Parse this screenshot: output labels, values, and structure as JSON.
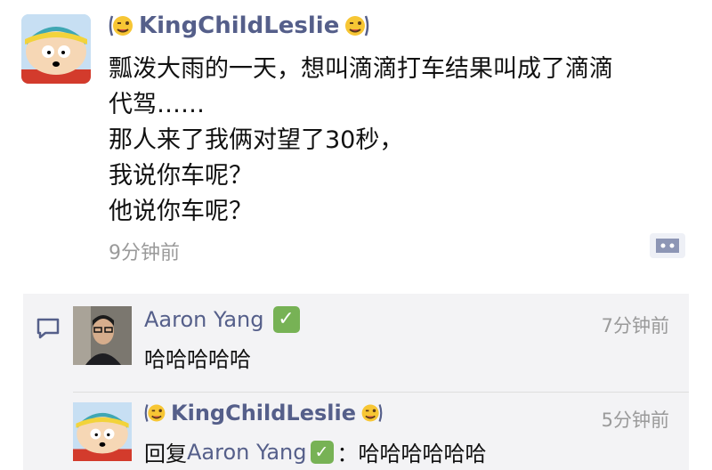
{
  "post": {
    "username": "KingChildLeslie",
    "text_lines": [
      "瓢泼大雨的一天，想叫滴滴打车结果叫成了滴滴",
      "代驾……",
      "那人来了我俩对望了30秒，",
      "我说你车呢？",
      "他说你车呢？"
    ],
    "time": "9分钟前",
    "more_icon": "ellipsis-bubble-icon"
  },
  "comments": [
    {
      "author": "Aaron Yang",
      "badge": "✓",
      "text": "哈哈哈哈哈",
      "time": "7分钟前"
    },
    {
      "author": "KingChildLeslie",
      "reply_prefix": "回复",
      "reply_to": "Aaron Yang",
      "badge": "✓",
      "colon": "：",
      "text": "哈哈哈哈哈哈",
      "time": "5分钟前"
    }
  ],
  "colors": {
    "name": "#555f8a",
    "timestamp": "#9a9a9a",
    "comment_bg": "#f3f3f5",
    "check_badge": "#77b255"
  }
}
